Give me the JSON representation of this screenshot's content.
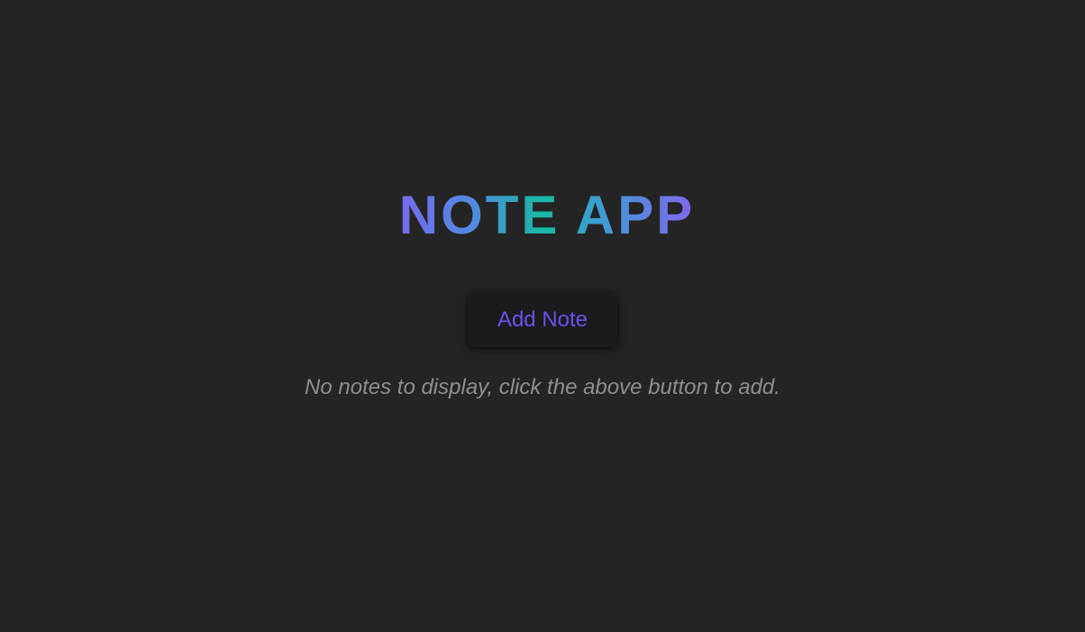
{
  "app": {
    "title": "NOTE APP"
  },
  "actions": {
    "add_note_label": "Add Note"
  },
  "notes": {
    "items": [],
    "empty_message": "No notes to display, click the above button to add."
  },
  "colors": {
    "background": "#242424",
    "button_background": "#1b1b1b",
    "button_text": "#6b4ff0",
    "empty_text": "#8f8f8f",
    "title_gradient": [
      "#7a67f2",
      "#4f8ce0",
      "#18b9a4",
      "#3f9bd6",
      "#8266f0"
    ]
  }
}
